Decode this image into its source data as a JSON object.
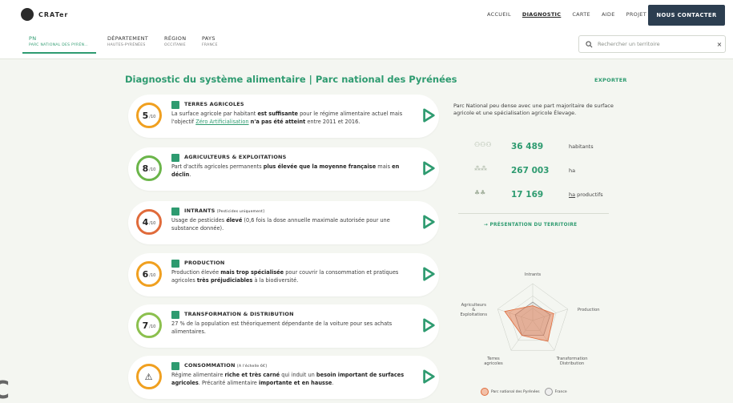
{
  "logo": {
    "text": "CRATer"
  },
  "nav": {
    "items": [
      "ACCUEIL",
      "DIAGNOSTIC",
      "CARTE",
      "AIDE",
      "PROJET"
    ],
    "active": "DIAGNOSTIC",
    "contact": "NOUS CONTACTER"
  },
  "breadcrumb": [
    {
      "level": "PN",
      "name": "PARC NATIONAL DES PYRÉN…",
      "active": true
    },
    {
      "level": "DÉPARTEMENT",
      "name": "HAUTES-PYRÉNÉES",
      "active": false
    },
    {
      "level": "RÉGION",
      "name": "OCCITANIE",
      "active": false
    },
    {
      "level": "PAYS",
      "name": "FRANCE",
      "active": false
    }
  ],
  "search": {
    "placeholder": "Rechercher un territoire",
    "clear": "×"
  },
  "page": {
    "title": "Diagnostic du système alimentaire | Parc national des Pyrénées",
    "export": "EXPORTER"
  },
  "colors": {
    "accent": "#2e9b70",
    "warning": "#f0a020",
    "danger": "#e06b3b",
    "ok": "#6bb54a"
  },
  "cards": [
    {
      "score": "5",
      "den": "/10",
      "ring": "#f0a020",
      "title": "TERRES AGRICOLES",
      "tag": "",
      "icon": "field-icon",
      "html": "La surface agricole par habitant <b>est suffisante</b> pour le régime alimentaire actuel mais l'objectif <u>Zéro Artificialisation</u> <b>n'a pas été atteint</b> entre 2011 et 2016."
    },
    {
      "score": "8",
      "den": "/10",
      "ring": "#6bb54a",
      "title": "AGRICULTEURS & EXPLOITATIONS",
      "tag": "",
      "icon": "farmer-icon",
      "html": "Part d'actifs agricoles permanents <b>plus élevée que la moyenne française</b> mais <b>en déclin</b>."
    },
    {
      "score": "4",
      "den": "/10",
      "ring": "#e06b3b",
      "title": "INTRANTS",
      "tag": "[Pesticides uniquement]",
      "icon": "pesticide-icon",
      "html": "Usage de pesticides <b>élevé</b> (0,6 fois la dose annuelle maximale autorisée pour une substance donnée)."
    },
    {
      "score": "6",
      "den": "/10",
      "ring": "#f0a020",
      "title": "PRODUCTION",
      "tag": "",
      "icon": "production-icon",
      "html": "Production élevée <b>mais trop spécialisée</b> pour couvrir la consommation et pratiques agricoles <b>très préjudiciables</b> à la biodiversité."
    },
    {
      "score": "7",
      "den": "/10",
      "ring": "#8cc04e",
      "title": "TRANSFORMATION & DISTRIBUTION",
      "tag": "",
      "icon": "truck-icon",
      "html": "27 % de la population est théoriquement dépendante de la voiture pour ses achats alimentaires."
    },
    {
      "score": "⚠",
      "den": "",
      "ring": "#f0a020",
      "title": "CONSOMMATION",
      "tag": "[A l'échelle 6€]",
      "icon": "basket-icon",
      "html": "Régime alimentaire <b>riche et très carné</b> qui induit un <b>besoin important de surfaces agricoles</b>. Précarité alimentaire <b>importante et en hausse</b>."
    }
  ],
  "summary": "Parc National peu dense avec une part majoritaire de surface agricole et une spécialisation agricole Élevage.",
  "stats": [
    {
      "icon": "people-icon",
      "value": "36 489",
      "unit": "habitants"
    },
    {
      "icon": "land-icon",
      "value": "267 003",
      "unit": "ha"
    },
    {
      "icon": "crops-icon",
      "value": "17 169",
      "unit": "ha productifs"
    }
  ],
  "presentation_link": "→ PRÉSENTATION DU TERRITOIRE",
  "radar": {
    "axes": [
      "Intrants",
      "Production",
      "Transformation\nDistribution",
      "Terres\nagricoles",
      "Agriculteurs\n&\nExploitations"
    ],
    "series": [
      {
        "name": "Parc national des Pyrénées",
        "values": [
          4,
          6,
          7,
          5,
          8
        ],
        "color": "#e06b3b"
      },
      {
        "name": "France",
        "values": [
          5,
          5,
          5,
          5,
          5
        ],
        "color": "#999999"
      }
    ]
  }
}
